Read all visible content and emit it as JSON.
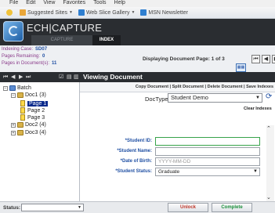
{
  "browser": {
    "menu": [
      "File",
      "Edit",
      "View",
      "Favorites",
      "Tools",
      "Help"
    ],
    "favorites": [
      {
        "label": "Suggested Sites",
        "icon": "suggested-sites-icon",
        "color": "#e8a63a"
      },
      {
        "label": "Web Slice Gallery",
        "icon": "web-slice-icon",
        "color": "#2f7fd0"
      },
      {
        "label": "MSN Newsletter",
        "icon": "msn-icon",
        "color": "#2f7fd0"
      }
    ]
  },
  "app": {
    "brand": "ECH|CAPTURE",
    "tabs": [
      {
        "label": "CAPTURE"
      },
      {
        "label": "INDEX"
      }
    ]
  },
  "info": {
    "indexing_case_label": "Indexing Case:",
    "indexing_case_value": "SD07",
    "pages_remaining_label": "Pages Remaining:",
    "pages_remaining_value": "0",
    "pages_in_docs_label": "Pages in Document(s):",
    "pages_in_docs_value": "11",
    "displaying": "Displaying Document Page: 1 of 3"
  },
  "tree": {
    "root": "Batch",
    "doc1": "Doc1 (3)",
    "pages": [
      "Page 1",
      "Page 2",
      "Page 3"
    ],
    "doc2": "Doc2 (4)",
    "doc3": "Doc3 (4)"
  },
  "viewing": {
    "title": "Viewing Document",
    "actions": [
      "Copy Document",
      "Split Document",
      "Delete Document",
      "Save Indexes"
    ],
    "doctype_label": "DocType:",
    "doctype_value": "Student Demo",
    "clear_indexes": "Clear Indexes",
    "fields": [
      {
        "label": "*Student ID:",
        "value": ""
      },
      {
        "label": "*Student Name:",
        "value": ""
      },
      {
        "label": "*Date of Birth:",
        "value": "",
        "placeholder": "YYYY-MM-DD"
      },
      {
        "label": "*Student Status:",
        "value": "Graduate"
      }
    ]
  },
  "statusbar": {
    "status_label": "Status:",
    "status_value": "",
    "unlock": "Unlock",
    "complete": "Complete"
  },
  "colors": {
    "header": "#2a2d31",
    "accent": "#1f4fa3",
    "selected": "#0a2a8c"
  }
}
